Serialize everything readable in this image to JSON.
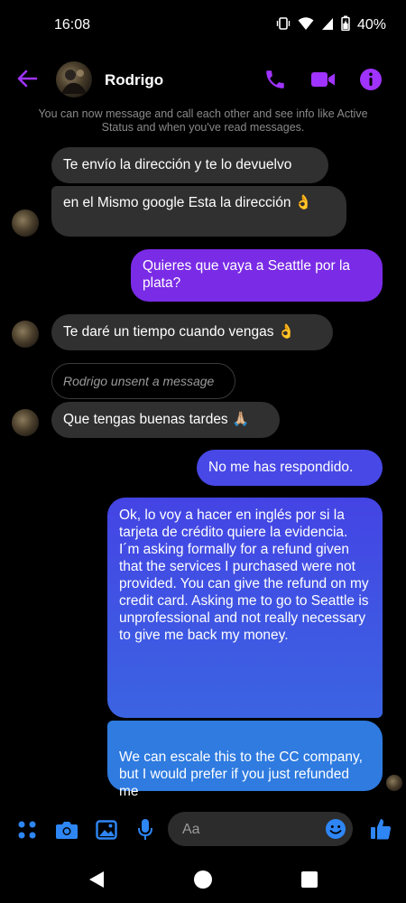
{
  "status_bar": {
    "time": "16:08",
    "battery": "40%",
    "icons": [
      "vibrate-icon",
      "wifi-icon",
      "signal-icon",
      "battery-icon"
    ]
  },
  "header": {
    "contact_name": "Rodrigo",
    "icons": [
      "back-arrow-icon",
      "phone-icon",
      "video-icon",
      "info-icon"
    ]
  },
  "system_notice": "You can now message and call each other and see info like Active Status and when you've read messages.",
  "messages": [
    {
      "direction": "incoming",
      "text": "Te envío la dirección y te lo devuelvo"
    },
    {
      "direction": "incoming",
      "text": "en el Mismo google Esta la dirección 👌"
    },
    {
      "direction": "outgoing",
      "text": "Quieres que vaya a Seattle por la plata?"
    },
    {
      "direction": "incoming",
      "text": "Te daré un tiempo cuando vengas 👌"
    },
    {
      "direction": "system",
      "text": "Rodrigo unsent a message"
    },
    {
      "direction": "incoming",
      "text": "Que tengas buenas tardes 🙏🏼"
    },
    {
      "direction": "outgoing",
      "text": "No me has respondido."
    },
    {
      "direction": "outgoing",
      "text": "Ok, lo voy a hacer en inglés por si la tarjeta de crédito quiere la evidencia.\nI´m asking formally for a refund given that the services I purchased were not provided. You can give the refund on my credit card. Asking me to go to Seattle is unprofessional and not really necessary to give me back my money."
    },
    {
      "direction": "outgoing",
      "text": "We can escale this to the CC company, but I would prefer if you just refunded me"
    }
  ],
  "composer": {
    "placeholder": "Aa",
    "icons": [
      "apps-icon",
      "camera-icon",
      "gallery-icon",
      "microphone-icon",
      "emoji-icon",
      "thumbs-up-icon"
    ]
  },
  "colors": {
    "accent": "#A033FF",
    "outgoing_top": "#8A2BE2",
    "outgoing_bottom": "#2F7BE0",
    "composer_icons": "#2E86F5",
    "incoming_bubble": "#303030"
  }
}
